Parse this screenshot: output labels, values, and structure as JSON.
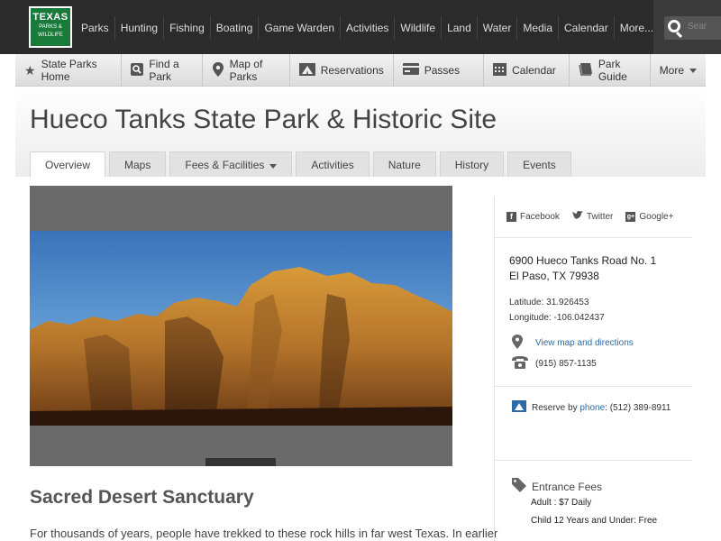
{
  "topnav": {
    "logo": {
      "line1": "TEXAS",
      "line2": "PARKS &",
      "line3": "WILDLIFE"
    },
    "items": [
      "Parks",
      "Hunting",
      "Fishing",
      "Boating",
      "Game Warden",
      "Activities",
      "Wildlife",
      "Land",
      "Water",
      "Media",
      "Calendar",
      "More..."
    ],
    "search_placeholder": "Sear"
  },
  "subnav": {
    "items": [
      {
        "label": "State Parks Home",
        "icon": "star-icon"
      },
      {
        "label": "Find a Park",
        "icon": "search-icon"
      },
      {
        "label": "Map of Parks",
        "icon": "map-pin-icon"
      },
      {
        "label": "Reservations",
        "icon": "tent-icon"
      },
      {
        "label": "Passes",
        "icon": "card-icon"
      },
      {
        "label": "Calendar",
        "icon": "calendar-icon"
      },
      {
        "label": "Park Guide",
        "icon": "book-icon"
      },
      {
        "label": "More",
        "icon": "chevron-down-icon"
      }
    ]
  },
  "page": {
    "title": "Hueco Tanks State Park & Historic Site",
    "tabs": [
      "Overview",
      "Maps",
      "Fees & Facilities",
      "Activities",
      "Nature",
      "History",
      "Events"
    ],
    "active_tab": "Overview"
  },
  "main": {
    "heading": "Sacred Desert Sanctuary",
    "paragraph": "For thousands of years, people have trekked to these rock hills in far west Texas. In earlier"
  },
  "sidebar": {
    "social": {
      "facebook": "Facebook",
      "twitter": "Twitter",
      "google": "Google+"
    },
    "address1": "6900 Hueco Tanks Road No. 1",
    "address2": "El Paso, TX 79938",
    "latitude": "Latitude: 31.926453",
    "longitude": "Longitude: -106.042437",
    "map_link": "View map and directions",
    "phone": "(915) 857-1135",
    "reserve_prefix": "Reserve by",
    "reserve_link": "phone",
    "reserve_phone": ": (512) 389-8911",
    "fees_title": "Entrance Fees",
    "fee_adult": "Adult : $7 Daily",
    "fee_child": "Child 12 Years and Under: Free"
  },
  "colors": {
    "brand_green": "#1a7a3a",
    "link_blue": "#2a6aa8",
    "topbar": "#2b2b2b"
  }
}
